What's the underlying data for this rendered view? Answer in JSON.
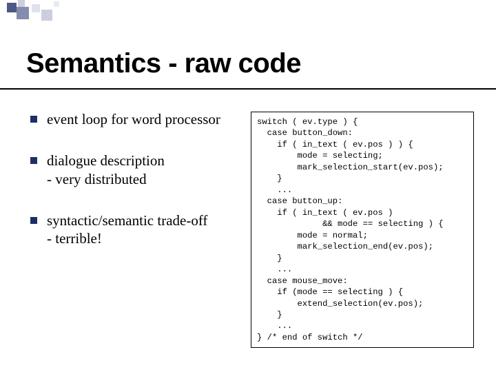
{
  "title": "Semantics - raw code",
  "bullets": [
    {
      "text": "event loop for word processor"
    },
    {
      "text": "dialogue description\n- very distributed"
    },
    {
      "text": "syntactic/semantic trade-off\n- terrible!"
    }
  ],
  "code": "switch ( ev.type ) {\n  case button_down:\n    if ( in_text ( ev.pos ) ) {\n        mode = selecting;\n        mark_selection_start(ev.pos);\n    }\n    ...\n  case button_up:\n    if ( in_text ( ev.pos )\n             && mode == selecting ) {\n        mode = normal;\n        mark_selection_end(ev.pos);\n    }\n    ...\n  case mouse_move:\n    if (mode == selecting ) {\n        extend_selection(ev.pos);\n    }\n    ...\n} /* end of switch */"
}
